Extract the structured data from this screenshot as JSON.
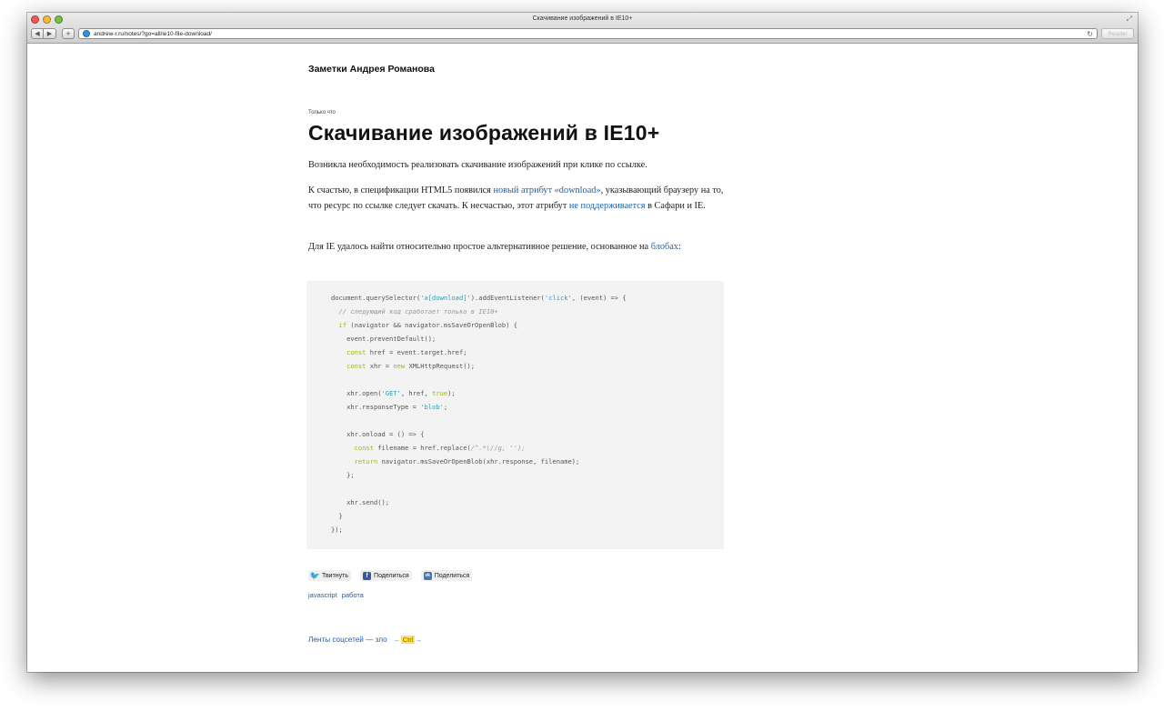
{
  "browser": {
    "window_title": "Скачивание изображений в IE10+",
    "url": "andrew-r.ru/notes/?go=all/ie10-file-download/",
    "back_label": "◀",
    "forward_label": "▶",
    "add_label": "+",
    "reload_label": "↻",
    "reader_label": "Reader",
    "resize_label": "⤢"
  },
  "page": {
    "site_title": "Заметки Андрея Романова",
    "post_date": "Только что",
    "post_title": "Скачивание изображений в IE10+",
    "p1": "Возникла необходимость реализовать скачивание изображений при клике по ссылке.",
    "p2_a": "К счастью, в спецификации HTML5 появился ",
    "p2_link1": "новый атрибут «download»",
    "p2_b": ", указывающий браузеру на то, что ресурс по ссылке следует скачать. К несчастью, этот атрибут ",
    "p2_link2": "не поддерживается",
    "p2_c": " в Сафари и IE.",
    "p3_a": "Для IE удалось найти относительно простое альтернативное решение, основанное на ",
    "p3_link": "блобах",
    "p3_b": ":"
  },
  "code_lines": [
    [
      [
        "document.querySelector(",
        ""
      ],
      [
        "'a[download]'",
        "str"
      ],
      [
        ").addEventListener(",
        ""
      ],
      [
        "'click'",
        "str"
      ],
      [
        ", (event) => {",
        ""
      ]
    ],
    [
      [
        "  // следующий код сработает только в IE10+",
        "cm"
      ]
    ],
    [
      [
        "  ",
        ""
      ],
      [
        "if",
        "kw"
      ],
      [
        " (navigator && navigator.msSaveOrOpenBlob) {",
        ""
      ]
    ],
    [
      [
        "    event.preventDefault();",
        ""
      ]
    ],
    [
      [
        "    ",
        ""
      ],
      [
        "const",
        "kw"
      ],
      [
        " href = event.target.href;",
        ""
      ]
    ],
    [
      [
        "    ",
        ""
      ],
      [
        "const",
        "kw"
      ],
      [
        " xhr = ",
        ""
      ],
      [
        "new",
        "kw"
      ],
      [
        " XMLHttpRequest();",
        ""
      ]
    ],
    [
      [
        "",
        ""
      ]
    ],
    [
      [
        "    xhr.open(",
        ""
      ],
      [
        "'GET'",
        "str"
      ],
      [
        ", href, ",
        ""
      ],
      [
        "true",
        "kw"
      ],
      [
        ");",
        ""
      ]
    ],
    [
      [
        "    xhr.responseType = ",
        ""
      ],
      [
        "'blob'",
        "str"
      ],
      [
        ";",
        ""
      ]
    ],
    [
      [
        "",
        ""
      ]
    ],
    [
      [
        "    xhr.onload = () => {",
        ""
      ]
    ],
    [
      [
        "      ",
        ""
      ],
      [
        "const",
        "kw"
      ],
      [
        " filename = href.replace(",
        ""
      ],
      [
        "/^.*\\//g, ''",
        "cm"
      ],
      [
        ");",
        "cm"
      ]
    ],
    [
      [
        "      ",
        ""
      ],
      [
        "return",
        "kw"
      ],
      [
        " navigator.msSaveOrOpenBlob(xhr.response, filename);",
        ""
      ]
    ],
    [
      [
        "    };",
        ""
      ]
    ],
    [
      [
        "",
        ""
      ]
    ],
    [
      [
        "    xhr.send();",
        ""
      ]
    ],
    [
      [
        "  }",
        ""
      ]
    ],
    [
      [
        "});",
        ""
      ]
    ]
  ],
  "share": {
    "twitter_label": "Твитнуть",
    "facebook_label": "Поделиться",
    "vk_label": "Поделиться",
    "facebook_icon": "f",
    "vk_icon": "vk",
    "twitter_icon": "🐦"
  },
  "tags": [
    "javascript",
    "работа"
  ],
  "nav": {
    "prev_label": "Ленты соцсетей — зло",
    "left_arrow": "←",
    "ctrl_label": "Ctrl",
    "right_arrow": "→"
  },
  "colors": {
    "link": "#1f5fa6",
    "code_bg": "#f3f3f3",
    "string": "#2a9fb6",
    "keyword": "#a8b218",
    "ctrl_highlight": "#ffe15a"
  }
}
